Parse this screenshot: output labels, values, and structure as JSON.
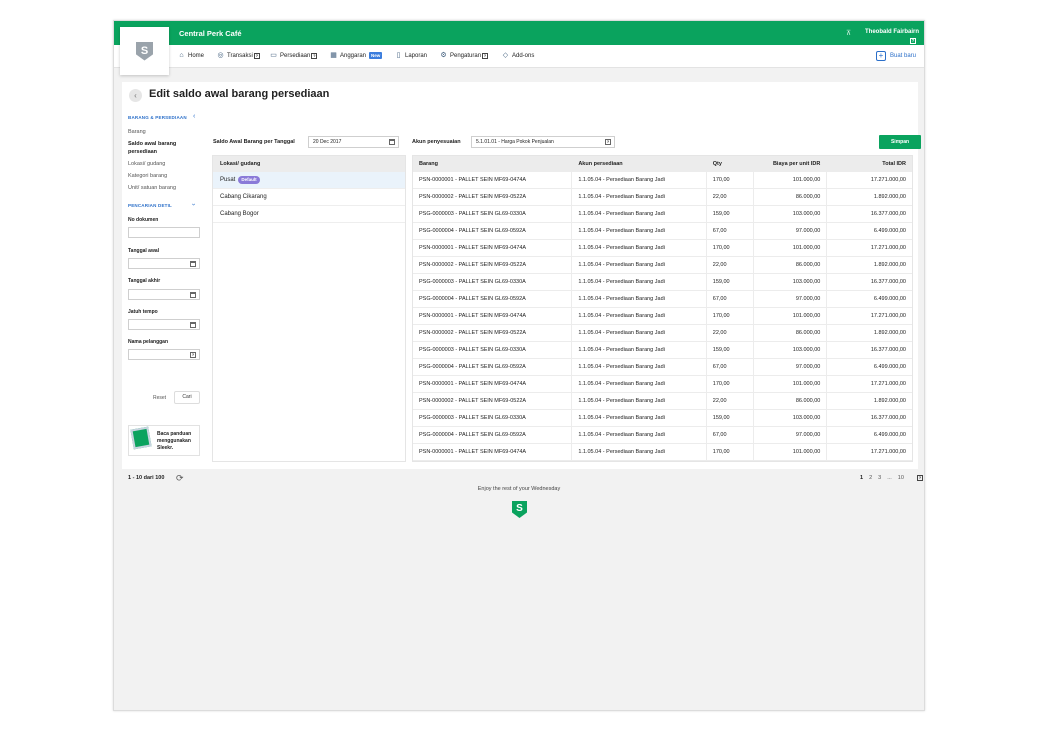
{
  "header": {
    "company": "Central Perk Café",
    "user_name": "Theobald Fairbairn",
    "help": "?",
    "logo_letter": "S"
  },
  "nav": {
    "items": [
      {
        "label": "Home",
        "icon": "home-icon",
        "help": false
      },
      {
        "label": "Transaksi",
        "icon": "transaction-icon",
        "help": true
      },
      {
        "label": "Persediaan",
        "icon": "inventory-icon",
        "help": true
      },
      {
        "label": "Anggaran",
        "icon": "budget-icon",
        "badge": "New",
        "help": false
      },
      {
        "label": "Laporan",
        "icon": "report-icon",
        "help": false
      },
      {
        "label": "Pengaturan",
        "icon": "settings-icon",
        "help": true
      },
      {
        "label": "Add-ons",
        "icon": "tag-icon",
        "help": false
      }
    ],
    "create_new": "Buat baru",
    "help_mark": "?"
  },
  "page": {
    "title": "Edit saldo awal barang persediaan",
    "back_glyph": "‹"
  },
  "sidebar": {
    "section_title": "BARANG & PERSEDIAAN",
    "links": [
      "Barang",
      "Saldo awal barang persediaan",
      "Lokasi/ gudang",
      "Kategori barang",
      "Unit/ satuan barang"
    ],
    "search_title": "PENCARIAN DETIL",
    "fields": {
      "no_dokumen": "No dokumen",
      "tanggal_awal": "Tanggal awal",
      "tanggal_akhir": "Tanggal akhir",
      "jatuh_tempo": "Jatuh tempo",
      "nama_pelanggan": "Nama pelanggan"
    },
    "reset": "Reset",
    "cari": "Cari",
    "promo": "Baca panduan menggunakan Sleekr."
  },
  "form": {
    "date_label": "Saldo Awal Barang per Tanggal",
    "date_value": "20 Dec 2017",
    "account_label": "Akun penyesuaian",
    "account_value": "5.1.01.01 - Harga Pokok Penjualan",
    "save": "Simpan"
  },
  "locations": {
    "header": "Lokasi/ gudang",
    "default_badge": "Default",
    "rows": [
      "Pusat",
      "Cabang Cikarang",
      "Cabang Bogor"
    ]
  },
  "table": {
    "columns": [
      "Barang",
      "Akun persediaan",
      "Qty",
      "Biaya per unit IDR",
      "Total IDR"
    ],
    "rows": [
      [
        "PSN-0000001 - PALLET SEIN MF69-0474A",
        "1.1.05.04 - Persediaan Barang Jadi",
        "170,00",
        "101.000,00",
        "17.271.000,00"
      ],
      [
        "PSN-0000002 - PALLET SEIN MF69-0522A",
        "1.1.05.04 - Persediaan Barang Jadi",
        "22,00",
        "86.000,00",
        "1.892.000,00"
      ],
      [
        "PSG-0000003 - PALLET SEIN GL69-0330A",
        "1.1.05.04 - Persediaan Barang Jadi",
        "159,00",
        "103.000,00",
        "16.377.000,00"
      ],
      [
        "PSG-0000004 - PALLET SEIN GL69-0592A",
        "1.1.05.04 - Persediaan Barang Jadi",
        "67,00",
        "97.000,00",
        "6.499.000,00"
      ],
      [
        "PSN-0000001 - PALLET SEIN MF69-0474A",
        "1.1.05.04 - Persediaan Barang Jadi",
        "170,00",
        "101.000,00",
        "17.271.000,00"
      ],
      [
        "PSN-0000002 - PALLET SEIN MF69-0522A",
        "1.1.05.04 - Persediaan Barang Jadi",
        "22,00",
        "86.000,00",
        "1.892.000,00"
      ],
      [
        "PSG-0000003 - PALLET SEIN GL69-0330A",
        "1.1.05.04 - Persediaan Barang Jadi",
        "159,00",
        "103.000,00",
        "16.377.000,00"
      ],
      [
        "PSG-0000004 - PALLET SEIN GL69-0592A",
        "1.1.05.04 - Persediaan Barang Jadi",
        "67,00",
        "97.000,00",
        "6.499.000,00"
      ],
      [
        "PSN-0000001 - PALLET SEIN MF69-0474A",
        "1.1.05.04 - Persediaan Barang Jadi",
        "170,00",
        "101.000,00",
        "17.271.000,00"
      ],
      [
        "PSN-0000002 - PALLET SEIN MF69-0522A",
        "1.1.05.04 - Persediaan Barang Jadi",
        "22,00",
        "86.000,00",
        "1.892.000,00"
      ],
      [
        "PSG-0000003 - PALLET SEIN GL69-0330A",
        "1.1.05.04 - Persediaan Barang Jadi",
        "159,00",
        "103.000,00",
        "16.377.000,00"
      ],
      [
        "PSG-0000004 - PALLET SEIN GL69-0592A",
        "1.1.05.04 - Persediaan Barang Jadi",
        "67,00",
        "97.000,00",
        "6.499.000,00"
      ],
      [
        "PSN-0000001 - PALLET SEIN MF69-0474A",
        "1.1.05.04 - Persediaan Barang Jadi",
        "170,00",
        "101.000,00",
        "17.271.000,00"
      ],
      [
        "PSN-0000002 - PALLET SEIN MF69-0522A",
        "1.1.05.04 - Persediaan Barang Jadi",
        "22,00",
        "86.000,00",
        "1.892.000,00"
      ],
      [
        "PSG-0000003 - PALLET SEIN GL69-0330A",
        "1.1.05.04 - Persediaan Barang Jadi",
        "159,00",
        "103.000,00",
        "16.377.000,00"
      ],
      [
        "PSG-0000004 - PALLET SEIN GL69-0592A",
        "1.1.05.04 - Persediaan Barang Jadi",
        "67,00",
        "97.000,00",
        "6.499.000,00"
      ],
      [
        "PSN-0000001 - PALLET SEIN MF69-0474A",
        "1.1.05.04 - Persediaan Barang Jadi",
        "170,00",
        "101.000,00",
        "17.271.000,00"
      ]
    ]
  },
  "pagination": {
    "summary": "1 - 10 dari 100",
    "pages": [
      "1",
      "2",
      "3",
      "...",
      "10"
    ],
    "active_page": "1"
  },
  "footer": {
    "message": "Enjoy the rest of your Wednesday"
  },
  "colors": {
    "brand_green": "#0aa35e",
    "link_blue": "#2b6fc9",
    "default_badge": "#8a7ad8"
  }
}
